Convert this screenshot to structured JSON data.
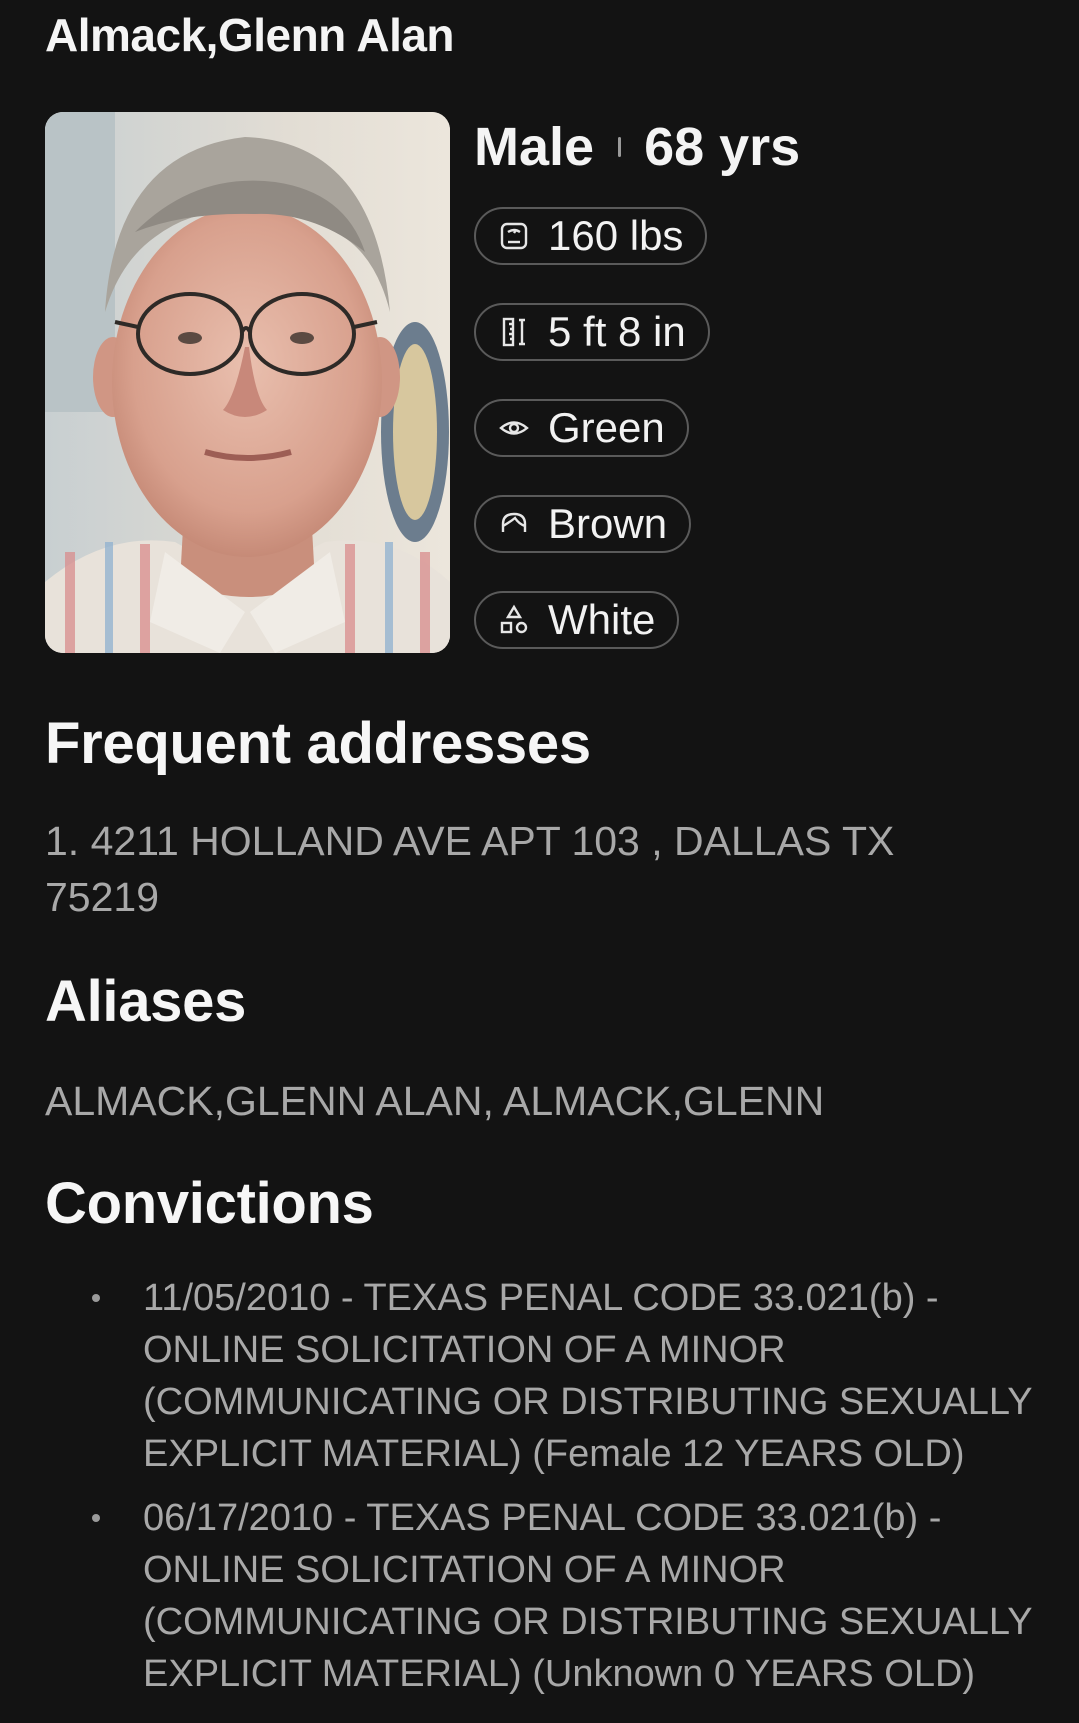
{
  "profile": {
    "name": "Almack,Glenn Alan",
    "sex": "Male",
    "age": "68 yrs",
    "weight": "160 lbs",
    "height": "5 ft 8 in",
    "eye_color": "Green",
    "hair_color": "Brown",
    "race": "White"
  },
  "icons": {
    "weight": "scale-icon",
    "height": "ruler-icon",
    "eye_color": "eye-icon",
    "hair_color": "hair-icon",
    "race": "shapes-icon"
  },
  "addresses": {
    "title": "Frequent addresses",
    "items": [
      "1. 4211 HOLLAND AVE APT 103 , DALLAS TX 75219"
    ]
  },
  "aliases": {
    "title": "Aliases",
    "text": "ALMACK,GLENN ALAN, ALMACK,GLENN"
  },
  "convictions": {
    "title": "Convictions",
    "items": [
      "11/05/2010 - TEXAS PENAL CODE 33.021(b) - ONLINE SOLICITATION OF A MINOR (COMMUNICATING OR DISTRIBUTING SEXUALLY EXPLICIT MATERIAL) (Female 12 YEARS OLD)",
      "06/17/2010 - TEXAS PENAL CODE 33.021(b) - ONLINE SOLICITATION OF A MINOR (COMMUNICATING OR DISTRIBUTING SEXUALLY EXPLICIT MATERIAL) (Unknown 0 YEARS OLD)"
    ]
  },
  "colors": {
    "background": "#131313",
    "heading": "#f4f4f4",
    "muted_text": "#a8a8a8",
    "chip_border": "#5a5a5a"
  }
}
